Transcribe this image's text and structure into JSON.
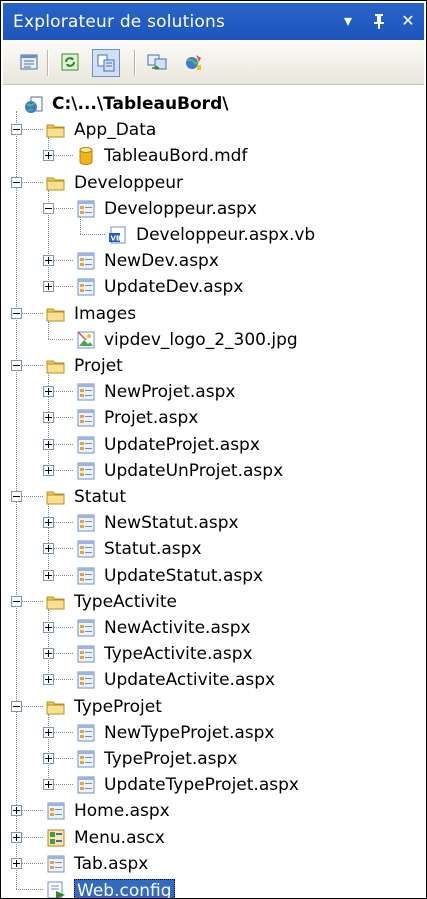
{
  "panel": {
    "title": "Explorateur de solutions",
    "dropdown_glyph": "▾",
    "pin_glyph": "ᵽ",
    "close_glyph": "✕"
  },
  "toolbar": {
    "buttons": [
      {
        "name": "properties-icon"
      },
      {
        "name": "refresh-icon"
      },
      {
        "name": "show-all-files-icon",
        "active": true
      },
      {
        "name": "copy-website-icon"
      },
      {
        "name": "asp-config-icon"
      }
    ]
  },
  "tree": [
    {
      "label": "C:\\...\\TableauBord\\",
      "level": 0,
      "icon": "website-icon",
      "bold": true,
      "expander": "none"
    },
    {
      "label": "App_Data",
      "level": 1,
      "icon": "folder-icon",
      "expander": "minus"
    },
    {
      "label": "TableauBord.mdf",
      "level": 2,
      "icon": "database-icon",
      "expander": "plus"
    },
    {
      "label": "Developpeur",
      "level": 1,
      "icon": "folder-icon",
      "expander": "minus"
    },
    {
      "label": "Developpeur.aspx",
      "level": 2,
      "icon": "aspx-page-icon",
      "expander": "minus"
    },
    {
      "label": "Developpeur.aspx.vb",
      "level": 3,
      "icon": "vb-file-icon",
      "expander": "none"
    },
    {
      "label": "NewDev.aspx",
      "level": 2,
      "icon": "aspx-page-icon",
      "expander": "plus"
    },
    {
      "label": "UpdateDev.aspx",
      "level": 2,
      "icon": "aspx-page-icon",
      "expander": "plus"
    },
    {
      "label": "Images",
      "level": 1,
      "icon": "folder-icon",
      "expander": "minus"
    },
    {
      "label": "vipdev_logo_2_300.jpg",
      "level": 2,
      "icon": "image-file-icon",
      "expander": "none"
    },
    {
      "label": "Projet",
      "level": 1,
      "icon": "folder-icon",
      "expander": "minus"
    },
    {
      "label": "NewProjet.aspx",
      "level": 2,
      "icon": "aspx-page-icon",
      "expander": "plus"
    },
    {
      "label": "Projet.aspx",
      "level": 2,
      "icon": "aspx-page-icon",
      "expander": "plus"
    },
    {
      "label": "UpdateProjet.aspx",
      "level": 2,
      "icon": "aspx-page-icon",
      "expander": "plus"
    },
    {
      "label": "UpdateUnProjet.aspx",
      "level": 2,
      "icon": "aspx-page-icon",
      "expander": "plus"
    },
    {
      "label": "Statut",
      "level": 1,
      "icon": "folder-icon",
      "expander": "minus"
    },
    {
      "label": "NewStatut.aspx",
      "level": 2,
      "icon": "aspx-page-icon",
      "expander": "plus"
    },
    {
      "label": "Statut.aspx",
      "level": 2,
      "icon": "aspx-page-icon",
      "expander": "plus"
    },
    {
      "label": "UpdateStatut.aspx",
      "level": 2,
      "icon": "aspx-page-icon",
      "expander": "plus"
    },
    {
      "label": "TypeActivite",
      "level": 1,
      "icon": "folder-icon",
      "expander": "minus"
    },
    {
      "label": "NewActivite.aspx",
      "level": 2,
      "icon": "aspx-page-icon",
      "expander": "plus"
    },
    {
      "label": "TypeActivite.aspx",
      "level": 2,
      "icon": "aspx-page-icon",
      "expander": "plus"
    },
    {
      "label": "UpdateActivite.aspx",
      "level": 2,
      "icon": "aspx-page-icon",
      "expander": "plus"
    },
    {
      "label": "TypeProjet",
      "level": 1,
      "icon": "folder-icon",
      "expander": "minus"
    },
    {
      "label": "NewTypeProjet.aspx",
      "level": 2,
      "icon": "aspx-page-icon",
      "expander": "plus"
    },
    {
      "label": "TypeProjet.aspx",
      "level": 2,
      "icon": "aspx-page-icon",
      "expander": "plus"
    },
    {
      "label": "UpdateTypeProjet.aspx",
      "level": 2,
      "icon": "aspx-page-icon",
      "expander": "plus"
    },
    {
      "label": "Home.aspx",
      "level": 1,
      "icon": "aspx-page-icon",
      "expander": "plus"
    },
    {
      "label": "Menu.ascx",
      "level": 1,
      "icon": "user-control-icon",
      "expander": "plus"
    },
    {
      "label": "Tab.aspx",
      "level": 1,
      "icon": "aspx-page-icon",
      "expander": "plus"
    },
    {
      "label": "Web.config",
      "level": 1,
      "icon": "config-file-icon",
      "expander": "none",
      "selected": true
    }
  ],
  "colors": {
    "title_bar": "#1d55bd",
    "selection": "#316ac5",
    "folder": "#f3c95a",
    "database": "#f1b417"
  }
}
